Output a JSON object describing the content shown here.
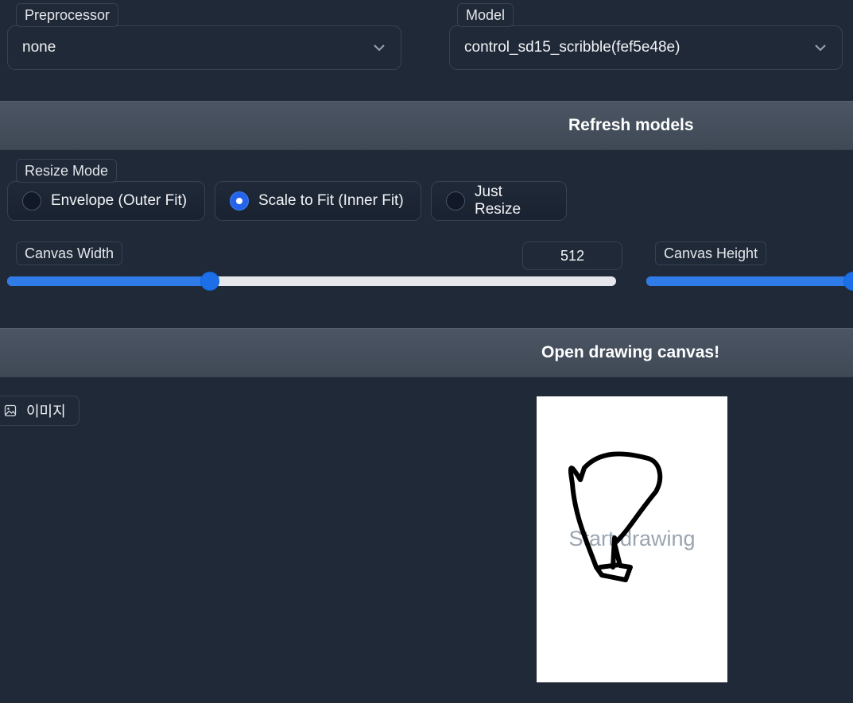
{
  "preprocessor": {
    "label": "Preprocessor",
    "value": "none"
  },
  "model": {
    "label": "Model",
    "value": "control_sd15_scribble(fef5e48e)"
  },
  "refresh_button": {
    "label": "Refresh models"
  },
  "resize_mode": {
    "label": "Resize Mode",
    "options": [
      {
        "label": "Envelope (Outer Fit)",
        "checked": false
      },
      {
        "label": "Scale to Fit (Inner Fit)",
        "checked": true
      },
      {
        "label": "Just Resize",
        "checked": false
      }
    ]
  },
  "canvas_width": {
    "label": "Canvas Width",
    "value": "512",
    "min": 256,
    "max": 1024
  },
  "canvas_height": {
    "label": "Canvas Height"
  },
  "open_canvas_button": {
    "label": "Open drawing canvas!"
  },
  "image_tab": {
    "label": "이미지",
    "icon": "image-icon"
  },
  "drawing": {
    "hint": "Start drawing"
  },
  "colors": {
    "accent": "#2f7ce8",
    "background": "#1f2937",
    "button_bar": "#4b5563"
  }
}
